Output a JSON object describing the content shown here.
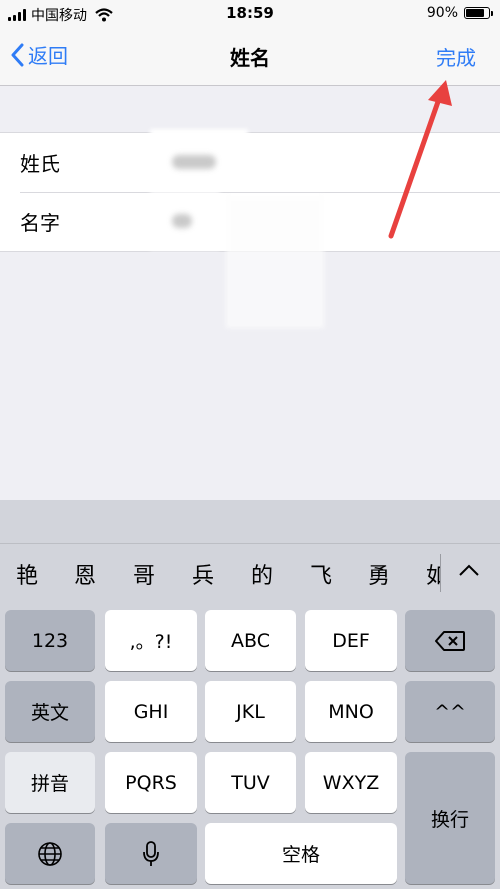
{
  "status_bar": {
    "carrier": "中国移动",
    "time": "18:59",
    "battery_percent": "90%",
    "battery_level": 0.9,
    "icons": [
      "signal-icon",
      "wifi-icon",
      "battery-icon"
    ]
  },
  "nav": {
    "back_label": "返回",
    "title": "姓名",
    "done_label": "完成"
  },
  "form": {
    "rows": [
      {
        "label": "姓氏",
        "value_note": "blurred"
      },
      {
        "label": "名字",
        "value_note": "blurred"
      }
    ]
  },
  "annotation": {
    "arrow_color": "#e8413f"
  },
  "keyboard": {
    "candidates": [
      "艳",
      "恩",
      "哥",
      "兵",
      "的",
      "飞",
      "勇",
      "如"
    ],
    "expand_icon": "chevron-up-icon",
    "keys": {
      "num": "123",
      "punct": ",。?!",
      "abc": "ABC",
      "def": "DEF",
      "eng": "英文",
      "ghi": "GHI",
      "jkl": "JKL",
      "mno": "MNO",
      "emoticon": "^^",
      "pinyin": "拼音",
      "pqrs": "PQRS",
      "tuv": "TUV",
      "wxyz": "WXYZ",
      "newline": "换行",
      "space": "空格"
    },
    "icons": [
      "delete-icon",
      "globe-icon",
      "microphone-icon"
    ]
  },
  "colors": {
    "accent": "#2f7cf6",
    "background": "#efeff4",
    "keyboard_bg": "#d2d4db"
  }
}
